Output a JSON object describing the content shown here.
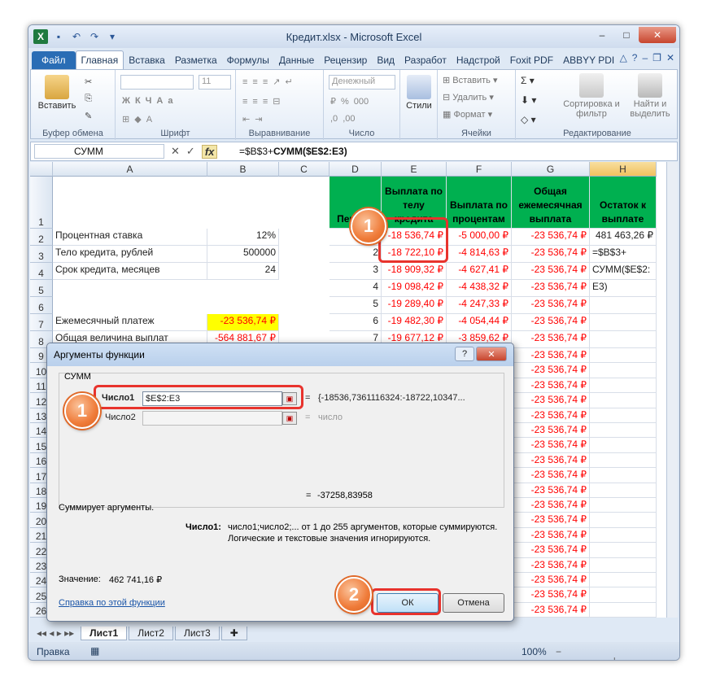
{
  "window": {
    "title": "Кредит.xlsx - Microsoft Excel"
  },
  "ribbon": {
    "tabs": [
      "Файл",
      "Главная",
      "Вставка",
      "Разметка",
      "Формулы",
      "Данные",
      "Рецензир",
      "Вид",
      "Разработ",
      "Надстрой",
      "Foxit PDF",
      "ABBYY PDI"
    ],
    "active_tab": "Главная",
    "paste_label": "Вставить",
    "clipboard_group": "Буфер обмена",
    "font_group": "Шрифт",
    "font_size": "11",
    "align_group": "Выравнивание",
    "number_format": "Денежный",
    "number_group": "Число",
    "styles_label": "Стили",
    "insert_label": "Вставить",
    "delete_label": "Удалить",
    "format_label": "Формат",
    "cells_group": "Ячейки",
    "sort_label": "Сортировка и фильтр",
    "find_label": "Найти и выделить",
    "editing_group": "Редактирование"
  },
  "formula_bar": {
    "name_box": "СУММ",
    "formula_prefix": "=$B$3+",
    "formula_bold": "СУММ($E$2:E3)"
  },
  "grid": {
    "columns": [
      "A",
      "B",
      "C",
      "D",
      "E",
      "F",
      "G",
      "H"
    ],
    "row1_headers": {
      "D": "Период",
      "E": "Выплата по телу кредита",
      "F": "Выплата по процентам",
      "G": "Общая ежемесячная выплата",
      "H": "Остаток к выплате"
    },
    "labels": {
      "a2": "Процентная ставка",
      "b2": "12%",
      "a3": "Тело кредита, рублей",
      "b3": "500000",
      "a4": "Срок кредита, месяцев",
      "b4": "24",
      "a7": "Ежемесячный платеж",
      "b7": "-23 536,74 ₽",
      "a8": "Общая величина выплат",
      "b8": "-564 881,67 ₽"
    },
    "rows": [
      {
        "n": "1",
        "d": "",
        "e": "-18 536,74 ₽",
        "f": "-5 000,00 ₽",
        "g": "-23 536,74 ₽",
        "h": "481 463,26 ₽"
      },
      {
        "n": "2",
        "d": "2",
        "e": "-18 722,10 ₽",
        "f": "-4 814,63 ₽",
        "g": "-23 536,74 ₽",
        "h": "=$B$3+"
      },
      {
        "n": "3",
        "d": "3",
        "e": "-18 909,32 ₽",
        "f": "-4 627,41 ₽",
        "g": "-23 536,74 ₽",
        "h": "СУММ($E$2:"
      },
      {
        "n": "4",
        "d": "4",
        "e": "-19 098,42 ₽",
        "f": "-4 438,32 ₽",
        "g": "-23 536,74 ₽",
        "h": "E3)"
      },
      {
        "n": "5",
        "d": "5",
        "e": "-19 289,40 ₽",
        "f": "-4 247,33 ₽",
        "g": "-23 536,74 ₽",
        "h": ""
      },
      {
        "n": "6",
        "d": "6",
        "e": "-19 482,30 ₽",
        "f": "-4 054,44 ₽",
        "g": "-23 536,74 ₽",
        "h": ""
      },
      {
        "n": "7",
        "d": "7",
        "e": "-19 677,12 ₽",
        "f": "-3 859,62 ₽",
        "g": "-23 536,74 ₽",
        "h": ""
      }
    ],
    "row_numbers": [
      "1",
      "2",
      "3",
      "4",
      "5",
      "6",
      "7",
      "8",
      "9",
      "10",
      "11",
      "12",
      "13",
      "14",
      "15",
      "16",
      "17",
      "18",
      "19",
      "20",
      "21",
      "22",
      "23",
      "24",
      "25",
      "26"
    ],
    "g_repeat": "-23 536,74 ₽"
  },
  "sheets": {
    "tabs": [
      "Лист1",
      "Лист2",
      "Лист3"
    ],
    "active": "Лист1"
  },
  "status": {
    "mode": "Правка",
    "zoom": "100%"
  },
  "dialog": {
    "title": "Аргументы функции",
    "function_name": "СУММ",
    "arg1_label": "Число1",
    "arg1_value": "$E$2:E3",
    "arg1_result": "{-18536,7361116324:-18722,10347...",
    "arg2_label": "Число2",
    "arg2_hint": "число",
    "total_result": "-37258,83958",
    "description": "Суммирует аргументы.",
    "help_label": "Число1:",
    "help_text_1": "число1;число2;... от 1 до 255 аргументов, которые суммируются.",
    "help_text_2": "Логические и текстовые значения игнорируются.",
    "value_label": "Значение:",
    "value": "462 741,16 ₽",
    "help_link": "Справка по этой функции",
    "ok": "ОК",
    "cancel": "Отмена",
    "eq": "="
  },
  "badges": {
    "one": "1",
    "two": "2"
  },
  "colors": {
    "header_green": "#00b050",
    "highlight_yellow": "#ffff00",
    "negative_red": "#ff0000",
    "callout_red": "#e8332d",
    "badge_orange": "#ef7b39"
  }
}
